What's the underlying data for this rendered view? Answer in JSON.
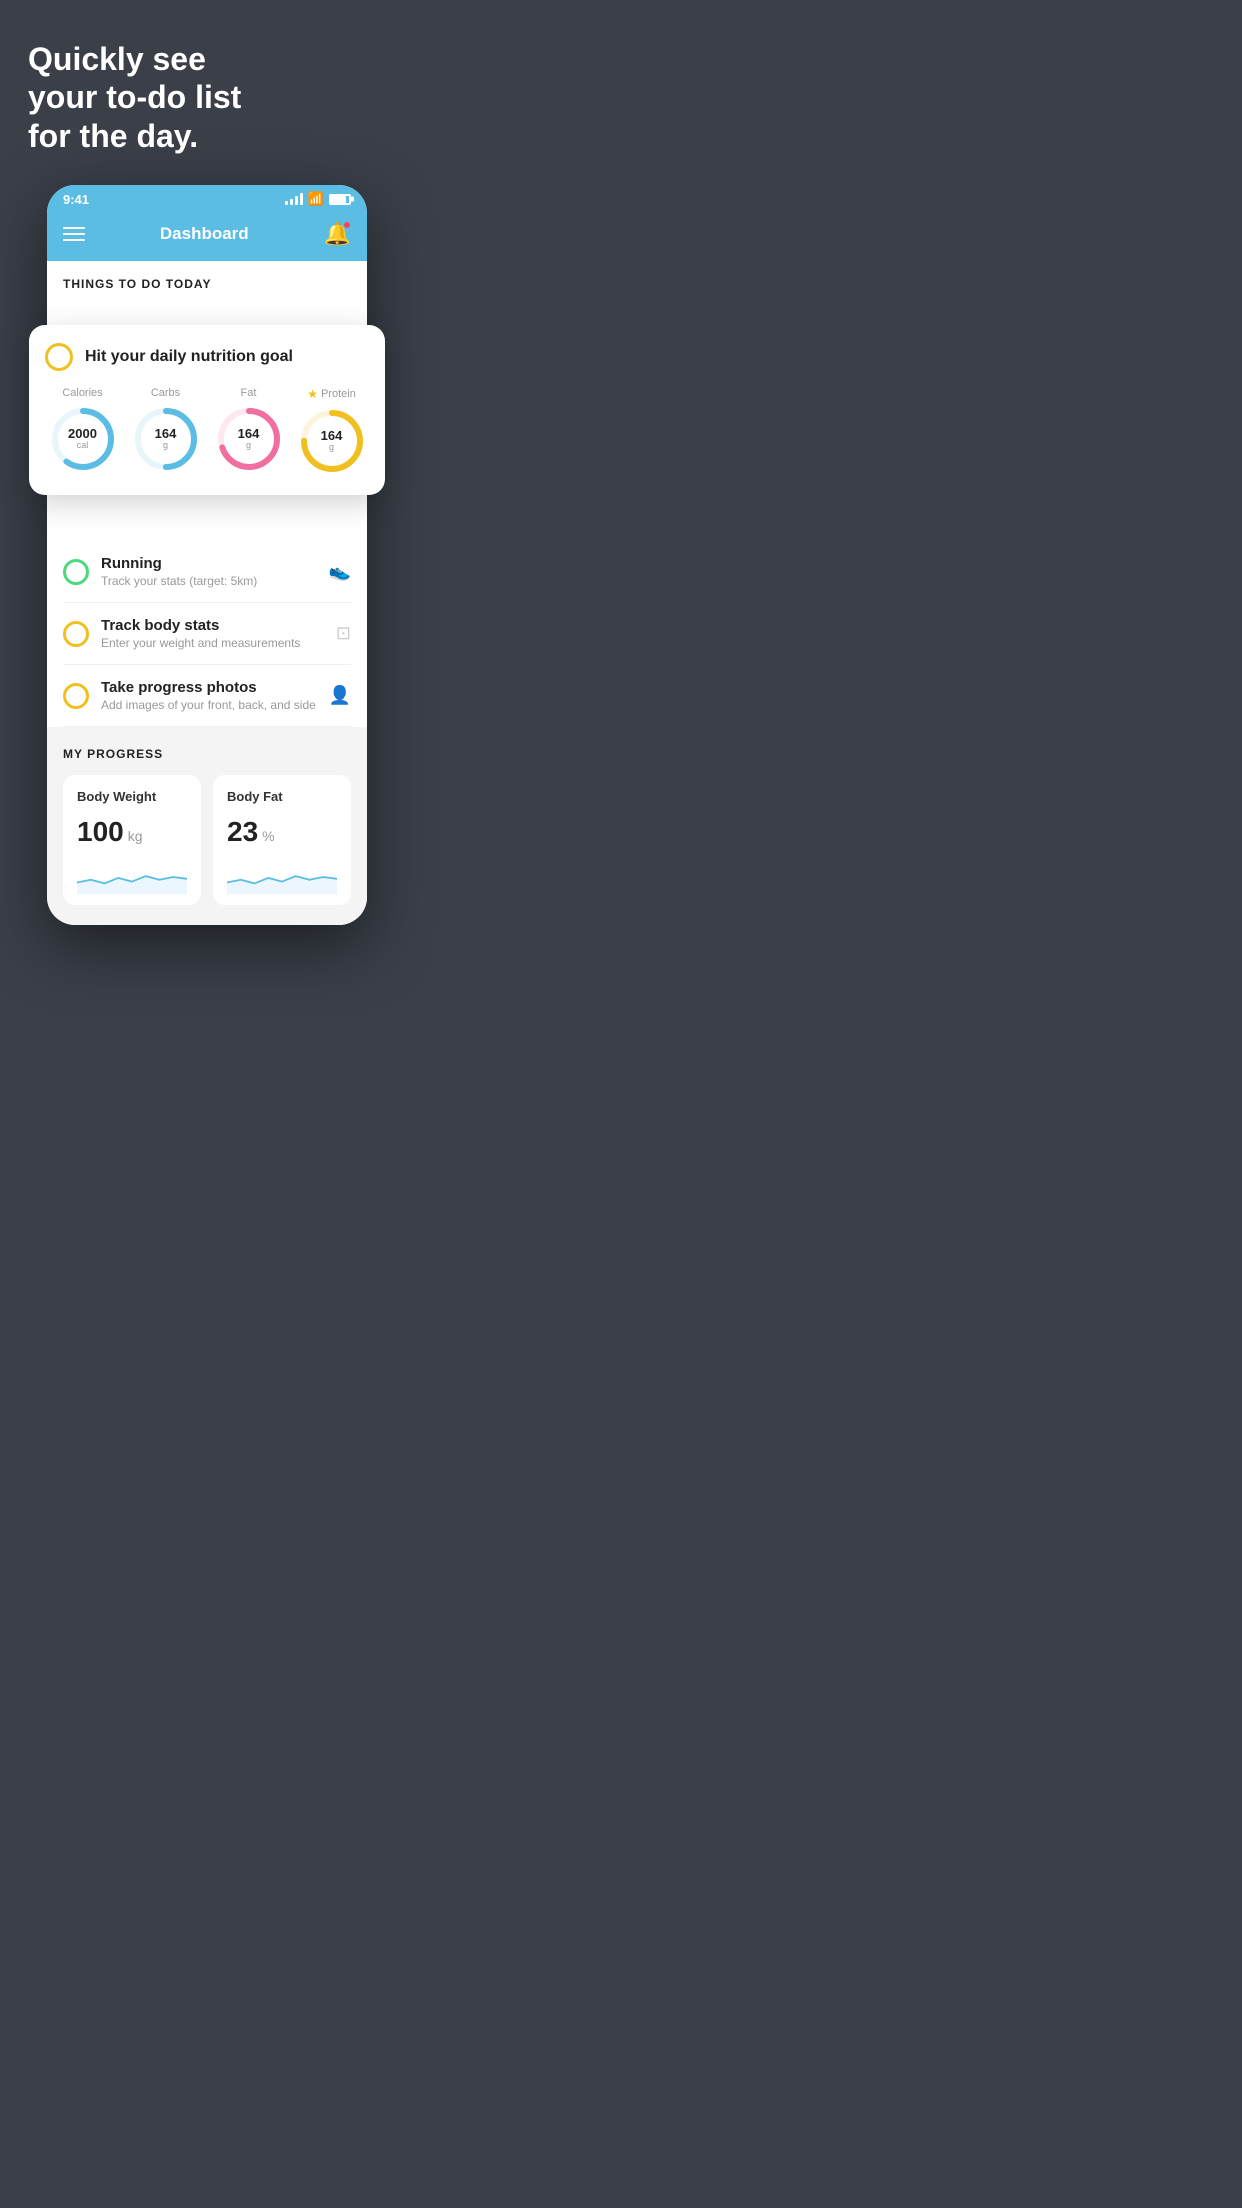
{
  "headline": {
    "line1": "Quickly see",
    "line2": "your to-do list",
    "line3": "for the day."
  },
  "status_bar": {
    "time": "9:41"
  },
  "nav": {
    "title": "Dashboard"
  },
  "section_title": "THINGS TO DO TODAY",
  "nutrition_card": {
    "title": "Hit your daily nutrition goal",
    "items": [
      {
        "label": "Calories",
        "value": "2000",
        "unit": "cal",
        "color": "#5bbde4",
        "track_color": "#e8f6fc",
        "progress": 0.6,
        "star": false
      },
      {
        "label": "Carbs",
        "value": "164",
        "unit": "g",
        "color": "#5bbde4",
        "track_color": "#e8f6fc",
        "progress": 0.5,
        "star": false
      },
      {
        "label": "Fat",
        "value": "164",
        "unit": "g",
        "color": "#f06fa0",
        "track_color": "#fde8f1",
        "progress": 0.7,
        "star": false
      },
      {
        "label": "Protein",
        "value": "164",
        "unit": "g",
        "color": "#f0c020",
        "track_color": "#fdf4dd",
        "progress": 0.75,
        "star": true
      }
    ]
  },
  "todo_items": [
    {
      "name": "Running",
      "desc": "Track your stats (target: 5km)",
      "circle": "green",
      "icon": "👟"
    },
    {
      "name": "Track body stats",
      "desc": "Enter your weight and measurements",
      "circle": "yellow",
      "icon": "⊡"
    },
    {
      "name": "Take progress photos",
      "desc": "Add images of your front, back, and side",
      "circle": "yellow",
      "icon": "👤"
    }
  ],
  "progress_section": {
    "title": "MY PROGRESS",
    "cards": [
      {
        "title": "Body Weight",
        "value": "100",
        "unit": "kg"
      },
      {
        "title": "Body Fat",
        "value": "23",
        "unit": "%"
      }
    ]
  }
}
